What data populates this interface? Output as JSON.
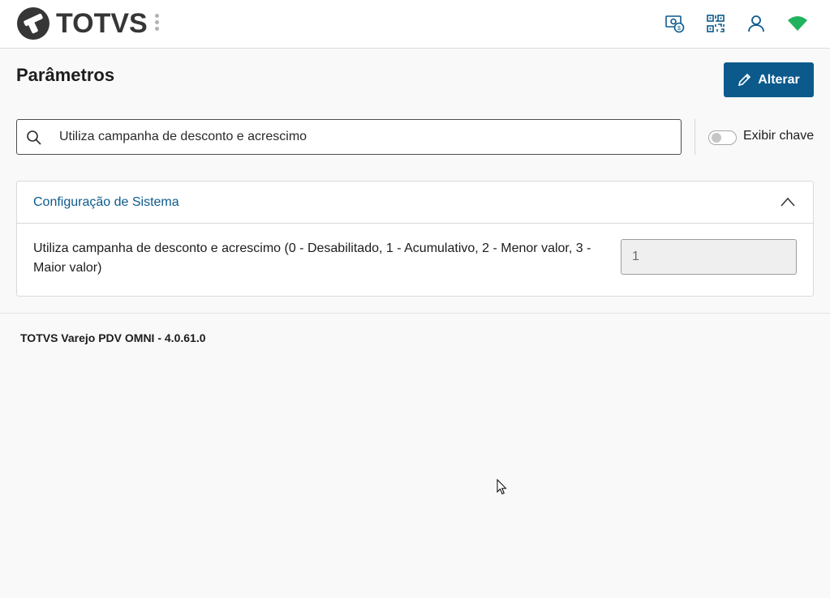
{
  "header": {
    "logo_text": "TOTVS",
    "icons": [
      "cash-register-icon",
      "qr-code-icon",
      "user-icon",
      "wifi-icon"
    ],
    "accent_color": "#0c5a8c",
    "wifi_color": "#20b35d"
  },
  "page": {
    "title": "Parâmetros",
    "edit_button_label": "Alterar"
  },
  "search": {
    "value": "Utiliza campanha de desconto e acrescimo"
  },
  "toggle": {
    "label": "Exibir chave",
    "checked": false
  },
  "section": {
    "title": "Configuração de Sistema",
    "expanded": true,
    "params": [
      {
        "description": "Utiliza campanha de desconto e acrescimo (0 - Desabilitado, 1 - Acumulativo, 2 - Menor valor, 3 - Maior valor)",
        "value": "1"
      }
    ]
  },
  "footer": {
    "version_text": "TOTVS Varejo PDV OMNI - 4.0.61.0"
  }
}
